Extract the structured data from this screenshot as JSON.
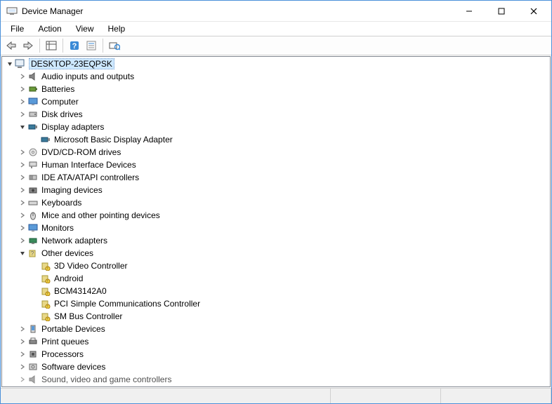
{
  "window": {
    "title": "Device Manager"
  },
  "menu": {
    "file": "File",
    "action": "Action",
    "view": "View",
    "help": "Help"
  },
  "tree": {
    "root": "DESKTOP-23EQPSK",
    "categories": {
      "audio": "Audio inputs and outputs",
      "batteries": "Batteries",
      "computer": "Computer",
      "disk": "Disk drives",
      "display": "Display adapters",
      "display_items": {
        "basic": "Microsoft Basic Display Adapter"
      },
      "dvd": "DVD/CD-ROM drives",
      "hid": "Human Interface Devices",
      "ide": "IDE ATA/ATAPI controllers",
      "imaging": "Imaging devices",
      "keyboards": "Keyboards",
      "mice": "Mice and other pointing devices",
      "monitors": "Monitors",
      "network": "Network adapters",
      "other": "Other devices",
      "other_items": {
        "3dvideo": "3D Video Controller",
        "android": "Android",
        "bcm": "BCM43142A0",
        "pci": "PCI Simple Communications Controller",
        "smbus": "SM Bus Controller"
      },
      "portable": "Portable Devices",
      "print": "Print queues",
      "processors": "Processors",
      "software": "Software devices",
      "sound": "Sound, video and game controllers"
    }
  }
}
